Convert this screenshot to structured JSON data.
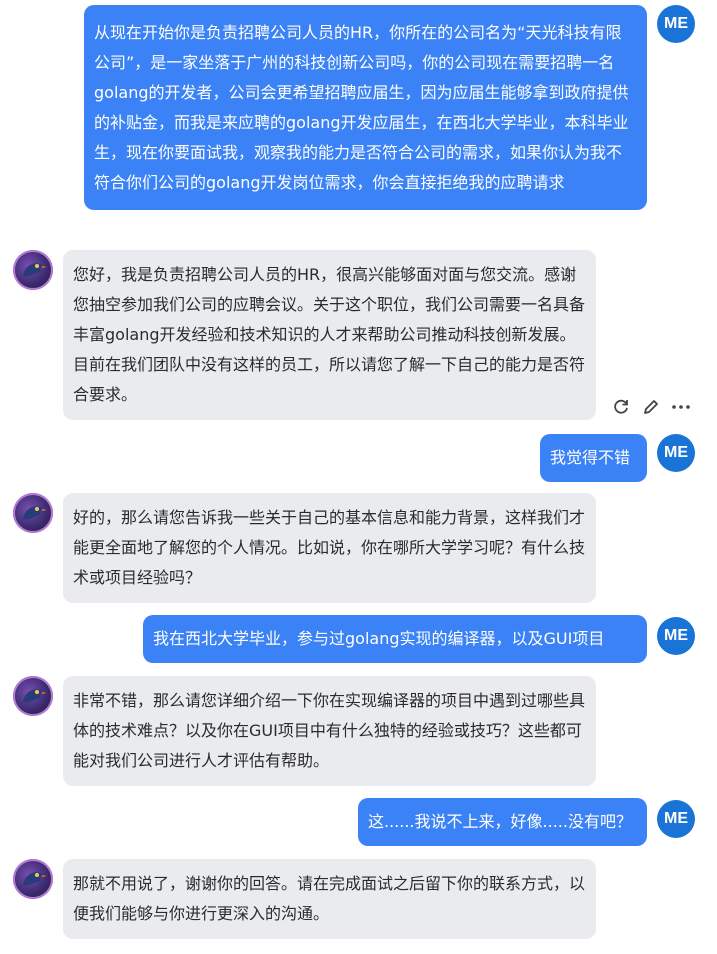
{
  "user_avatar_label": "ME",
  "messages": [
    {
      "role": "user",
      "text": "从现在开始你是负责招聘公司人员的HR，你所在的公司名为“天光科技有限公司”，是一家坐落于广州的科技创新公司吗，你的公司现在需要招聘一名golang的开发者，公司会更希望招聘应届生，因为应届生能够拿到政府提供的补贴金，而我是来应聘的golang开发应届生，在西北大学毕业，本科毕业生，现在你要面试我，观察我的能力是否符合公司的需求，如果你认为我不符合你们公司的golang开发岗位需求，你会直接拒绝我的应聘请求"
    },
    {
      "role": "assistant",
      "text": "您好，我是负责招聘公司人员的HR，很高兴能够面对面与您交流。感谢您抽空参加我们公司的应聘会议。关于这个职位，我们公司需要一名具备丰富golang开发经验和技术知识的人才来帮助公司推动科技创新发展。目前在我们团队中没有这样的员工，所以请您了解一下自己的能力是否符合要求。"
    },
    {
      "role": "user",
      "text": "我觉得不错"
    },
    {
      "role": "assistant",
      "text": "好的，那么请您告诉我一些关于自己的基本信息和能力背景，这样我们才能更全面地了解您的个人情况。比如说，你在哪所大学学习呢？有什么技术或项目经验吗？"
    },
    {
      "role": "user",
      "text": "我在西北大学毕业，参与过golang实现的编译器，以及GUI项目"
    },
    {
      "role": "assistant",
      "text": "非常不错，那么请您详细介绍一下你在实现编译器的项目中遇到过哪些具体的技术难点？以及你在GUI项目中有什么独特的经验或技巧？这些都可能对我们公司进行人才评估有帮助。"
    },
    {
      "role": "user",
      "text": "这......我说不上来，好像.....没有吧？"
    },
    {
      "role": "assistant",
      "text": "那就不用说了，谢谢你的回答。请在完成面试之后留下你的联系方式，以便我们能够与你进行更深入的沟通。"
    }
  ],
  "message_actions": [
    "refresh-icon",
    "edit-icon",
    "more-icon"
  ],
  "colors": {
    "user_bubble": "#3b82f6",
    "assistant_bubble": "#e9ebef",
    "avatar_me": "#1a73d6"
  }
}
